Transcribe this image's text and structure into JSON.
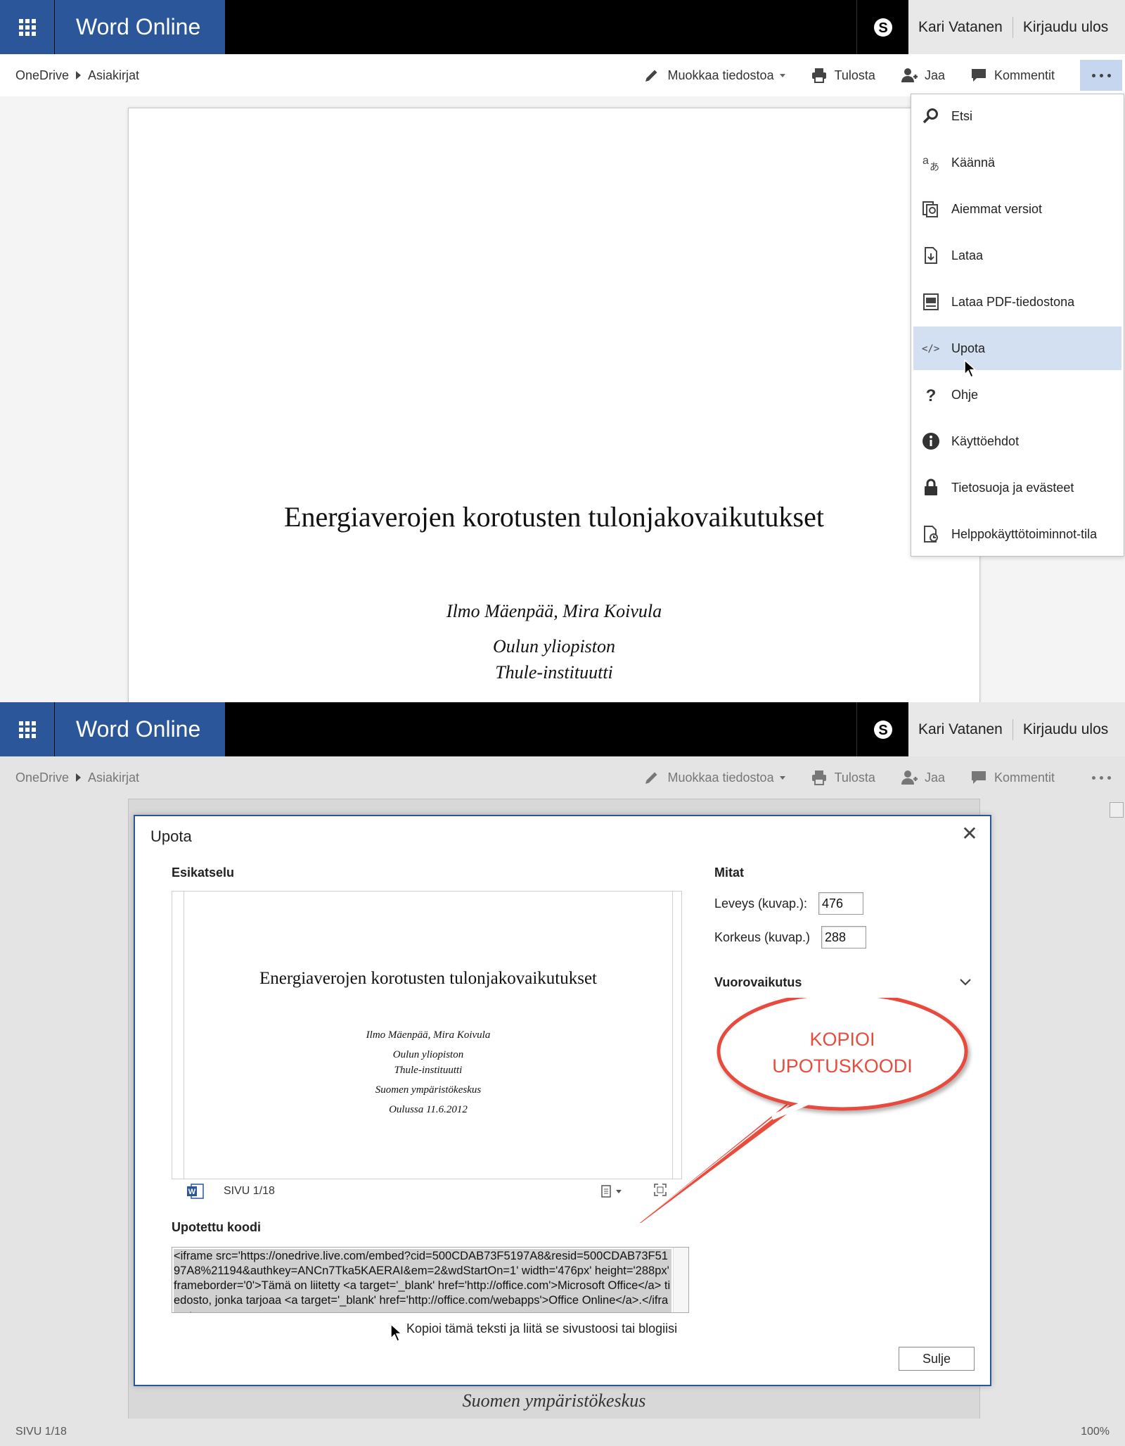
{
  "app": {
    "brand": "Word Online",
    "user_name": "Kari Vatanen",
    "signout": "Kirjaudu ulos"
  },
  "breadcrumb": [
    "OneDrive",
    "Asiakirjat"
  ],
  "toolbar": {
    "edit": "Muokkaa tiedostoa",
    "print": "Tulosta",
    "share": "Jaa",
    "comments": "Kommentit"
  },
  "document": {
    "title": "Energiaverojen korotusten tulonjakovaikutukset",
    "authors": "Ilmo Mäenpää, Mira Koivula",
    "org1": "Oulun yliopiston",
    "org2": "Thule-instituutti",
    "org3": "Suomen ympäristökeskus",
    "date": "Oulussa 11.6.2012"
  },
  "more_menu": {
    "items": [
      {
        "label": "Etsi",
        "icon": "search-icon"
      },
      {
        "label": "Käännä",
        "icon": "translate-icon"
      },
      {
        "label": "Aiemmat versiot",
        "icon": "versions-icon"
      },
      {
        "label": "Lataa",
        "icon": "download-icon"
      },
      {
        "label": "Lataa PDF-tiedostona",
        "icon": "pdf-icon"
      },
      {
        "label": "Upota",
        "icon": "embed-icon",
        "highlighted": true
      },
      {
        "label": "Ohje",
        "icon": "help-icon"
      },
      {
        "label": "Käyttöehdot",
        "icon": "info-icon"
      },
      {
        "label": "Tietosuoja ja evästeet",
        "icon": "lock-icon"
      },
      {
        "label": "Helppokäyttötoiminnot-tila",
        "icon": "accessibility-icon"
      }
    ]
  },
  "embed_dialog": {
    "title": "Upota",
    "preview_label": "Esikatselu",
    "page_indicator": "SIVU 1/18",
    "code_label": "Upotettu koodi",
    "code": "<iframe src='https://onedrive.live.com/embed?cid=500CDAB73F5197A8&resid=500CDAB73F5197A8%21194&authkey=ANCn7Tka5KAERAI&em=2&wdStartOn=1' width='476px' height='288px' frameborder='0'>Tämä on liitetty <a target='_blank' href='http://office.com'>Microsoft Office</a> tiedosto, jonka tarjoaa <a target='_blank' href='http://office.com/webapps'>Office Online</a>.</iframe>",
    "hint": "Kopioi tämä teksti ja liitä se sivustoosi tai blogiisi",
    "dimensions_label": "Mitat",
    "width_label": "Leveys (kuvap.):",
    "width_value": "476",
    "height_label": "Korkeus (kuvap.)",
    "height_value": "288",
    "interaction_label": "Vuorovaikutus",
    "close_button": "Sulje"
  },
  "callout": {
    "line1": "KOPIOI",
    "line2": "UPOTUSKOODI",
    "color": "#e84c3d"
  },
  "status": {
    "page": "SIVU 1/18",
    "zoom": "100%"
  },
  "colors": {
    "brand_blue": "#2b579a",
    "menu_highlight": "#d3e0f1"
  }
}
